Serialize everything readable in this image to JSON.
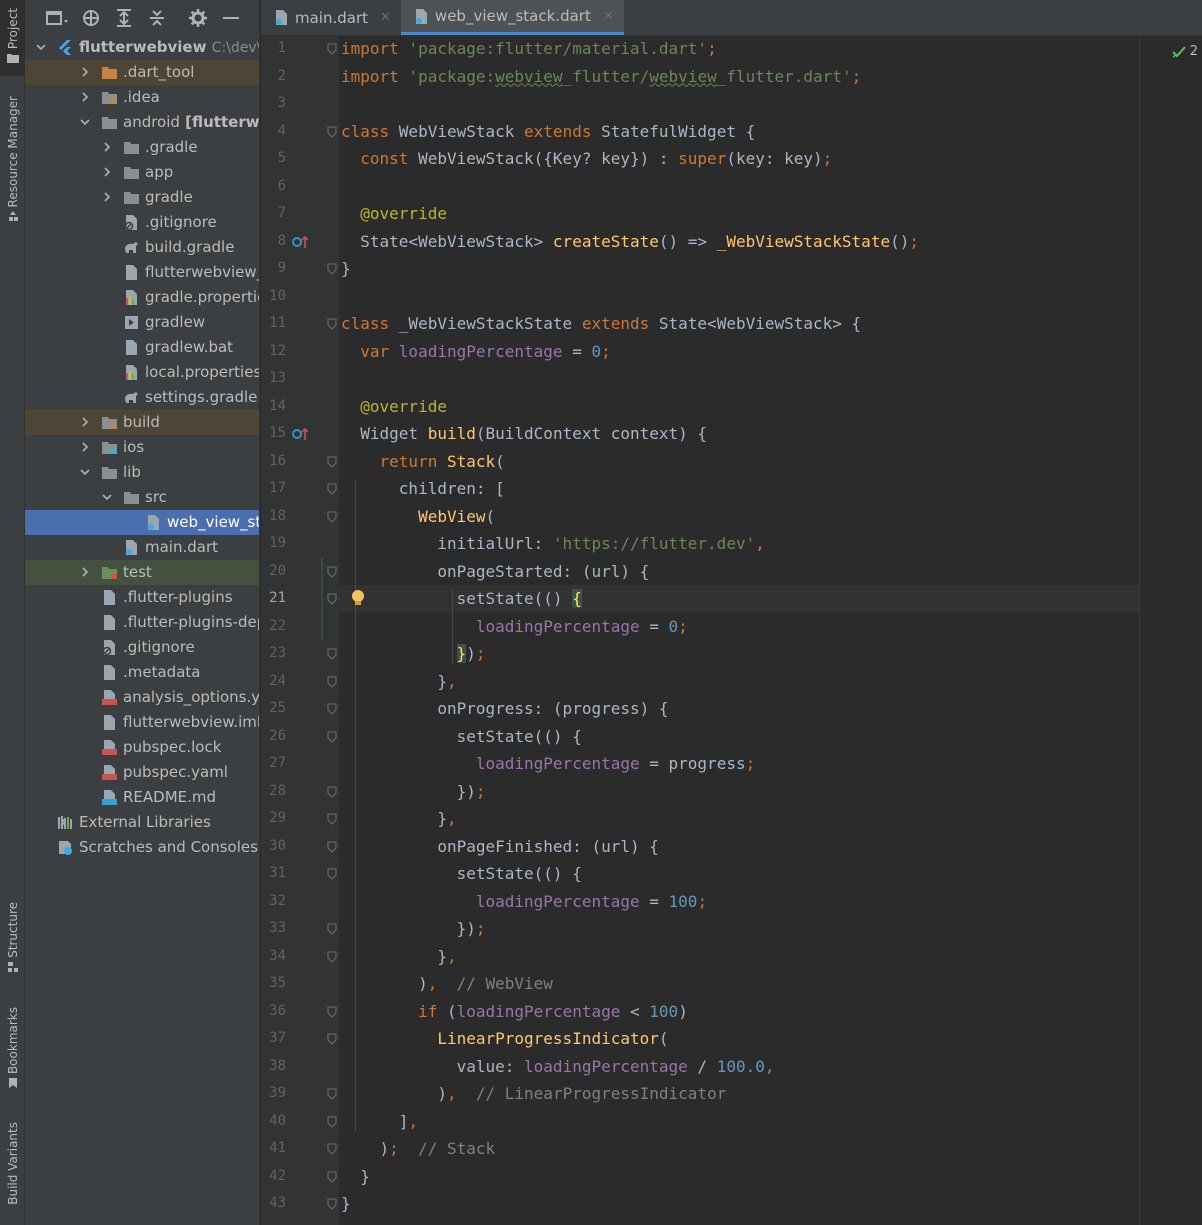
{
  "stripe": {
    "project": "Project",
    "resource_manager": "Resource Manager",
    "structure": "Structure",
    "bookmarks": "Bookmarks",
    "build_variants": "Build Variants"
  },
  "project_tree": {
    "root_name": "flutterwebview",
    "root_path": "C:\\dev\\S",
    "items": [
      {
        "label": ".dart_tool"
      },
      {
        "label": ".idea"
      },
      {
        "label": "android",
        "suffix": "[flutterwebvie"
      },
      {
        "label": ".gradle"
      },
      {
        "label": "app"
      },
      {
        "label": "gradle"
      },
      {
        "label": ".gitignore"
      },
      {
        "label": "build.gradle"
      },
      {
        "label": "flutterwebview_andr"
      },
      {
        "label": "gradle.properties"
      },
      {
        "label": "gradlew"
      },
      {
        "label": "gradlew.bat"
      },
      {
        "label": "local.properties"
      },
      {
        "label": "settings.gradle"
      },
      {
        "label": "build"
      },
      {
        "label": "ios"
      },
      {
        "label": "lib"
      },
      {
        "label": "src"
      },
      {
        "label": "web_view_stack.d"
      },
      {
        "label": "main.dart"
      },
      {
        "label": "test"
      },
      {
        "label": ".flutter-plugins"
      },
      {
        "label": ".flutter-plugins-depend"
      },
      {
        "label": ".gitignore"
      },
      {
        "label": ".metadata"
      },
      {
        "label": "analysis_options.yaml"
      },
      {
        "label": "flutterwebview.iml"
      },
      {
        "label": "pubspec.lock"
      },
      {
        "label": "pubspec.yaml"
      },
      {
        "label": "README.md"
      },
      {
        "label": "External Libraries"
      },
      {
        "label": "Scratches and Consoles"
      }
    ]
  },
  "tabs": [
    {
      "label": "main.dart"
    },
    {
      "label": "web_view_stack.dart"
    }
  ],
  "inspections": {
    "count": "2"
  },
  "editor": {
    "current_line": 21,
    "line_numbers": [
      "1",
      "2",
      "3",
      "4",
      "5",
      "6",
      "7",
      "8",
      "9",
      "10",
      "11",
      "12",
      "13",
      "14",
      "15",
      "16",
      "17",
      "18",
      "19",
      "20",
      "21",
      "22",
      "23",
      "24",
      "25",
      "26",
      "27",
      "28",
      "29",
      "30",
      "31",
      "32",
      "33",
      "34",
      "35",
      "36",
      "37",
      "38",
      "39",
      "40",
      "41",
      "42",
      "43"
    ],
    "lines": [
      [
        [
          "kw",
          "import "
        ],
        [
          "str",
          "'package:flutter/material.dart'"
        ],
        [
          "kw",
          ";"
        ]
      ],
      [
        [
          "kw",
          "import "
        ],
        [
          "str",
          "'package:"
        ],
        [
          "str squig",
          "webview"
        ],
        [
          "str",
          "_flutter/"
        ],
        [
          "str squig",
          "webview"
        ],
        [
          "str",
          "_flutter.dart'"
        ],
        [
          "kw",
          ";"
        ]
      ],
      [],
      [
        [
          "kw",
          "class "
        ],
        [
          "",
          "WebViewStack "
        ],
        [
          "kw",
          "extends "
        ],
        [
          "",
          "StatefulWidget {"
        ]
      ],
      [
        [
          "",
          "  "
        ],
        [
          "kw",
          "const "
        ],
        [
          "",
          "WebViewStack({Key? key}) : "
        ],
        [
          "kw",
          "super"
        ],
        [
          "",
          "(key: key)"
        ],
        [
          "kw",
          ";"
        ]
      ],
      [],
      [
        [
          "",
          "  "
        ],
        [
          "ann",
          "@override"
        ]
      ],
      [
        [
          "",
          "  State<WebViewStack> "
        ],
        [
          "fn",
          "createState"
        ],
        [
          "",
          "() => "
        ],
        [
          "fn",
          "_WebViewStackState"
        ],
        [
          "",
          "()"
        ],
        [
          "kw",
          ";"
        ]
      ],
      [
        [
          "",
          "}"
        ]
      ],
      [],
      [
        [
          "kw",
          "class "
        ],
        [
          "",
          "_WebViewStackState "
        ],
        [
          "kw",
          "extends "
        ],
        [
          "",
          "State<WebViewStack> {"
        ]
      ],
      [
        [
          "",
          "  "
        ],
        [
          "kw",
          "var "
        ],
        [
          "fld",
          "loadingPercentage"
        ],
        [
          "",
          " = "
        ],
        [
          "num",
          "0"
        ],
        [
          "kw",
          ";"
        ]
      ],
      [],
      [
        [
          "",
          "  "
        ],
        [
          "ann",
          "@override"
        ]
      ],
      [
        [
          "",
          "  Widget "
        ],
        [
          "fn",
          "build"
        ],
        [
          "",
          "(BuildContext context) {"
        ]
      ],
      [
        [
          "",
          "    "
        ],
        [
          "kw",
          "return "
        ],
        [
          "fn",
          "Stack"
        ],
        [
          "",
          "("
        ]
      ],
      [
        [
          "",
          "      children: ["
        ]
      ],
      [
        [
          "",
          "        "
        ],
        [
          "fn",
          "WebView"
        ],
        [
          "",
          "("
        ]
      ],
      [
        [
          "",
          "          initialUrl: "
        ],
        [
          "str",
          "'https://flutter.dev'"
        ],
        [
          "kw",
          ","
        ]
      ],
      [
        [
          "",
          "          onPageStarted: (url) {"
        ]
      ],
      [
        [
          "",
          "            setState(() "
        ],
        [
          "bracket-hl",
          "{"
        ]
      ],
      [
        [
          "",
          "              "
        ],
        [
          "fld",
          "loadingPercentage"
        ],
        [
          "",
          " = "
        ],
        [
          "num",
          "0"
        ],
        [
          "kw",
          ";"
        ]
      ],
      [
        [
          "",
          "            "
        ],
        [
          "bracket-hl",
          "}"
        ],
        [
          "",
          ")"
        ],
        [
          "kw",
          ";"
        ]
      ],
      [
        [
          "",
          "          }"
        ],
        [
          "kw",
          ","
        ]
      ],
      [
        [
          "",
          "          onProgress: (progress) {"
        ]
      ],
      [
        [
          "",
          "            setState(() {"
        ]
      ],
      [
        [
          "",
          "              "
        ],
        [
          "fld",
          "loadingPercentage"
        ],
        [
          "",
          " = progress"
        ],
        [
          "kw",
          ";"
        ]
      ],
      [
        [
          "",
          "            })"
        ],
        [
          "kw",
          ";"
        ]
      ],
      [
        [
          "",
          "          }"
        ],
        [
          "kw",
          ","
        ]
      ],
      [
        [
          "",
          "          onPageFinished: (url) {"
        ]
      ],
      [
        [
          "",
          "            setState(() {"
        ]
      ],
      [
        [
          "",
          "              "
        ],
        [
          "fld",
          "loadingPercentage"
        ],
        [
          "",
          " = "
        ],
        [
          "num",
          "100"
        ],
        [
          "kw",
          ";"
        ]
      ],
      [
        [
          "",
          "            })"
        ],
        [
          "kw",
          ";"
        ]
      ],
      [
        [
          "",
          "          }"
        ],
        [
          "kw",
          ","
        ]
      ],
      [
        [
          "",
          "        )"
        ],
        [
          "kw",
          ","
        ],
        [
          "cmt",
          "  // WebView"
        ]
      ],
      [
        [
          "",
          "        "
        ],
        [
          "kw",
          "if "
        ],
        [
          "",
          "("
        ],
        [
          "fld",
          "loadingPercentage"
        ],
        [
          "",
          " < "
        ],
        [
          "num",
          "100"
        ],
        [
          "",
          ")"
        ]
      ],
      [
        [
          "",
          "          "
        ],
        [
          "fn",
          "LinearProgressIndicator"
        ],
        [
          "",
          "("
        ]
      ],
      [
        [
          "",
          "            value: "
        ],
        [
          "fld",
          "loadingPercentage"
        ],
        [
          "",
          " / "
        ],
        [
          "num",
          "100.0"
        ],
        [
          "kw",
          ","
        ]
      ],
      [
        [
          "",
          "          )"
        ],
        [
          "kw",
          ","
        ],
        [
          "cmt",
          "  // LinearProgressIndicator"
        ]
      ],
      [
        [
          "",
          "      ]"
        ],
        [
          "kw",
          ","
        ]
      ],
      [
        [
          "",
          "    )"
        ],
        [
          "kw",
          ";"
        ],
        [
          "cmt",
          "  // Stack"
        ]
      ],
      [
        [
          "",
          "  }"
        ]
      ],
      [
        [
          "",
          "}"
        ]
      ]
    ]
  }
}
